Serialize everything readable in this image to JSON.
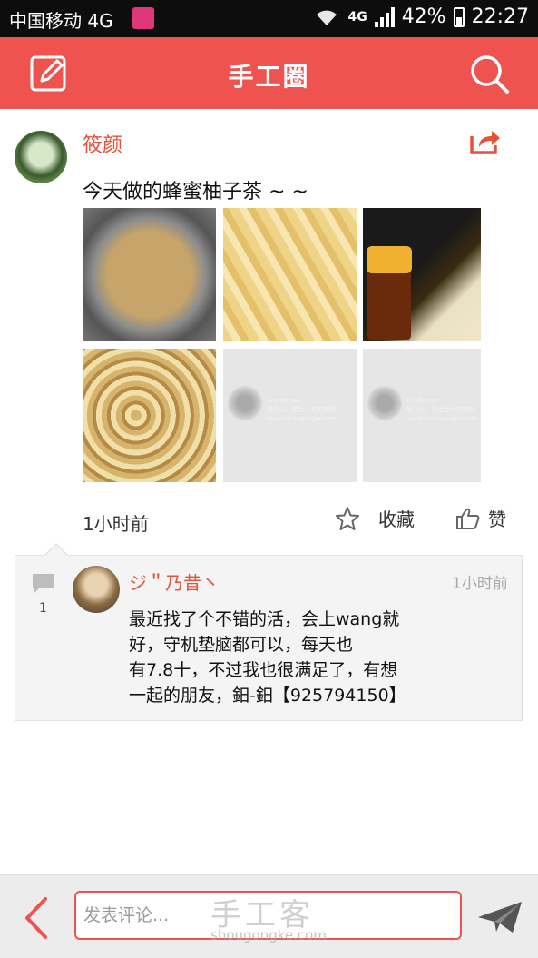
{
  "status_bar": {
    "carrier": "中国移动 4G",
    "network": "4G",
    "battery": "42%",
    "time": "22:27"
  },
  "header": {
    "title": "手工圈",
    "left_icon": "edit-icon",
    "right_icon": "search-icon",
    "color": "#ef5350"
  },
  "post": {
    "username": "筱颜",
    "text": "今天做的蜂蜜柚子茶 ~ ~",
    "time": "1小时前",
    "favorite_label": "收藏",
    "like_label": "赞",
    "thumbnail_watermark": [
      "Craftsman",
      "静下心，体会手作的美好",
      "www.shougongke.com"
    ]
  },
  "comments": {
    "count": "1",
    "items": [
      {
        "username": "ジ＂乃昔丶",
        "time": "1小时前",
        "text": "最近找了个不错的活，会上wang就\n好，守机垫脑都可以，每天也\n有7.8十，不过我也很满足了，有想\n一起的朋友，鈤-鈤【925794150】"
      }
    ]
  },
  "bottom_bar": {
    "comment_placeholder": "发表评论...",
    "watermark": "手工客",
    "watermark_url": "shougongke.com"
  }
}
